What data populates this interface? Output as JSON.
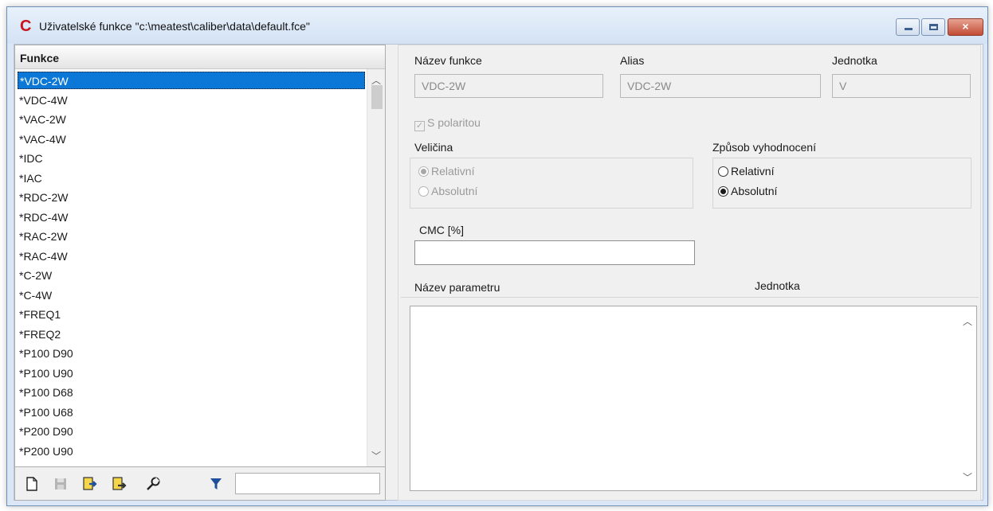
{
  "window": {
    "app_icon": "C",
    "title": "Uživatelské funkce \"c:\\meatest\\caliber\\data\\default.fce\"",
    "controls": {
      "minimize": "minimize-icon",
      "maximize": "maximize-icon",
      "close": "close-icon",
      "close_glyph": "×"
    }
  },
  "functions": {
    "header": "Funkce",
    "items": [
      "*VDC-2W",
      "*VDC-4W",
      "*VAC-2W",
      "*VAC-4W",
      "*IDC",
      "*IAC",
      "*RDC-2W",
      "*RDC-4W",
      "*RAC-2W",
      "*RAC-4W",
      "*C-2W",
      "*C-4W",
      "*FREQ1",
      "*FREQ2",
      "*P100 D90",
      "*P100 U90",
      "*P100 D68",
      "*P100 U68",
      "*P200 D90",
      "*P200 U90"
    ],
    "selected_index": 0,
    "toolbar": {
      "buttons": [
        "new-document-icon",
        "save-icon",
        "import-icon",
        "export-icon",
        "wrench-icon",
        "filter-icon"
      ],
      "filter_value": ""
    }
  },
  "details": {
    "name_label": "Název funkce",
    "name_value": "VDC-2W",
    "alias_label": "Alias",
    "alias_value": "VDC-2W",
    "unit_label": "Jednotka",
    "unit_value": "V",
    "polarity_label": "S polaritou",
    "polarity_checked": true,
    "quantity_label": "Veličina",
    "quantity_options": [
      "Relativní",
      "Absolutní"
    ],
    "quantity_selected": "Relativní",
    "evaluation_label": "Způsob vyhodnocení",
    "evaluation_options": [
      "Relativní",
      "Absolutní"
    ],
    "evaluation_selected": "Absolutní",
    "cmc_label": "CMC [%]",
    "cmc_value": "",
    "param_name_header": "Název parametru",
    "param_unit_header": "Jednotka"
  },
  "colors": {
    "selection": "#0b78d7",
    "app_icon": "#c8141e",
    "close_button": "#c24c36"
  }
}
